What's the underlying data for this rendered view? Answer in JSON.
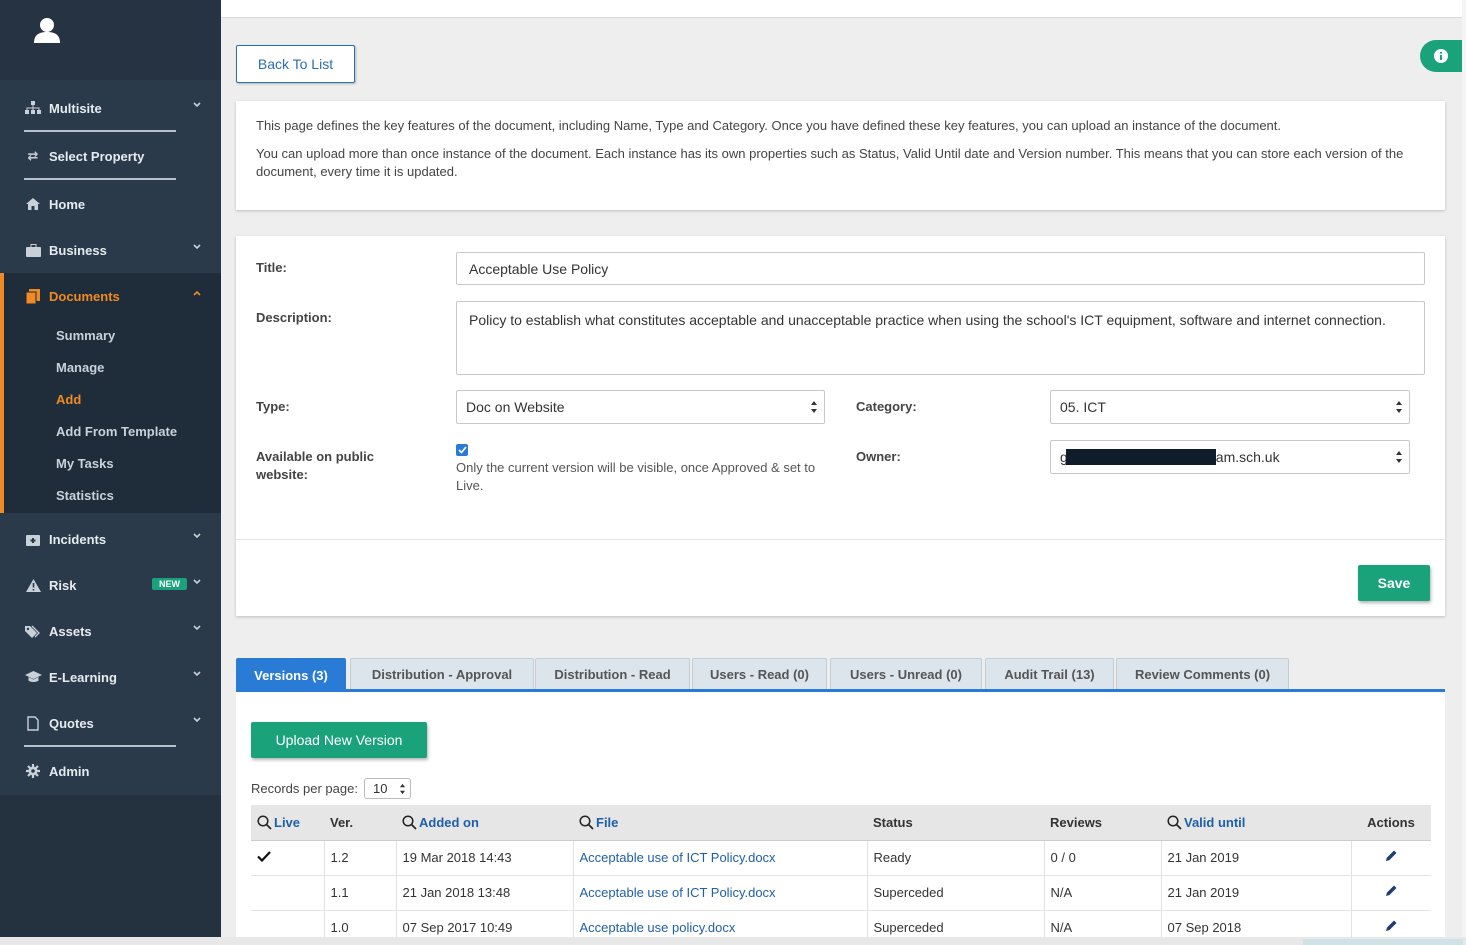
{
  "sidebar": {
    "user_name": "",
    "items": {
      "multisite": "Multisite",
      "select_property": "Select Property",
      "home": "Home",
      "business": "Business",
      "documents": "Documents",
      "incidents": "Incidents",
      "risk": "Risk",
      "assets": "Assets",
      "elearning": "E-Learning",
      "quotes": "Quotes",
      "admin": "Admin"
    },
    "risk_badge": "NEW",
    "documents_sub": [
      "Summary",
      "Manage",
      "Add",
      "Add From Template",
      "My Tasks",
      "Statistics"
    ],
    "active_sub": "Add",
    "accent_color": "#f08a24"
  },
  "back_button": "Back To List",
  "intro": {
    "p1": "This page defines the key features of the document, including Name, Type and Category. Once you have defined these key features, you can upload an instance of the document.",
    "p2": "You can upload more than once instance of the document. Each instance has its own properties such as Status, Valid Until date and Version number. This means that you can store each version of the document, every time it is updated."
  },
  "form": {
    "title_label": "Title:",
    "title_value": "Acceptable Use Policy",
    "description_label": "Description:",
    "description_value": "Policy to establish what constitutes acceptable and unacceptable practice when using the school's ICT equipment, software and internet connection.",
    "type_label": "Type:",
    "type_value": "Doc on Website",
    "category_label": "Category:",
    "category_value": "05. ICT",
    "public_label": "Available on public website:",
    "public_checked": true,
    "public_note": "Only the current version will be visible, once Approved & set to Live.",
    "owner_label": "Owner:",
    "owner_value_prefix": "g",
    "owner_value_suffix": "am.sch.uk",
    "save_label": "Save"
  },
  "tabs": [
    "Versions (3)",
    "Distribution - Approval",
    "Distribution - Read",
    "Users - Read (0)",
    "Users - Unread (0)",
    "Audit Trail (13)",
    "Review Comments (0)"
  ],
  "active_tab": "Versions (3)",
  "versions": {
    "upload_label": "Upload New Version",
    "records_label": "Records per page:",
    "records_value": "10",
    "columns": [
      "Live",
      "Ver.",
      "Added on",
      "File",
      "Status",
      "Reviews",
      "Valid until",
      "Actions"
    ],
    "rows": [
      {
        "live": true,
        "ver": "1.2",
        "added": "19 Mar 2018 14:43",
        "file": "Acceptable use of ICT Policy.docx",
        "status": "Ready",
        "reviews": "0 / 0",
        "valid": "21 Jan 2019"
      },
      {
        "live": false,
        "ver": "1.1",
        "added": "21 Jan 2018 13:48",
        "file": "Acceptable use of ICT Policy.docx",
        "status": "Superceded",
        "reviews": "N/A",
        "valid": "21 Jan 2019"
      },
      {
        "live": false,
        "ver": "1.0",
        "added": "07 Sep 2017 10:49",
        "file": "Acceptable use policy.docx",
        "status": "Superceded",
        "reviews": "N/A",
        "valid": "07 Sep 2018"
      }
    ]
  },
  "colors": {
    "sidebar_bg": "#2b3a4a",
    "primary_blue": "#2a7bd6",
    "green": "#1aa37a"
  }
}
